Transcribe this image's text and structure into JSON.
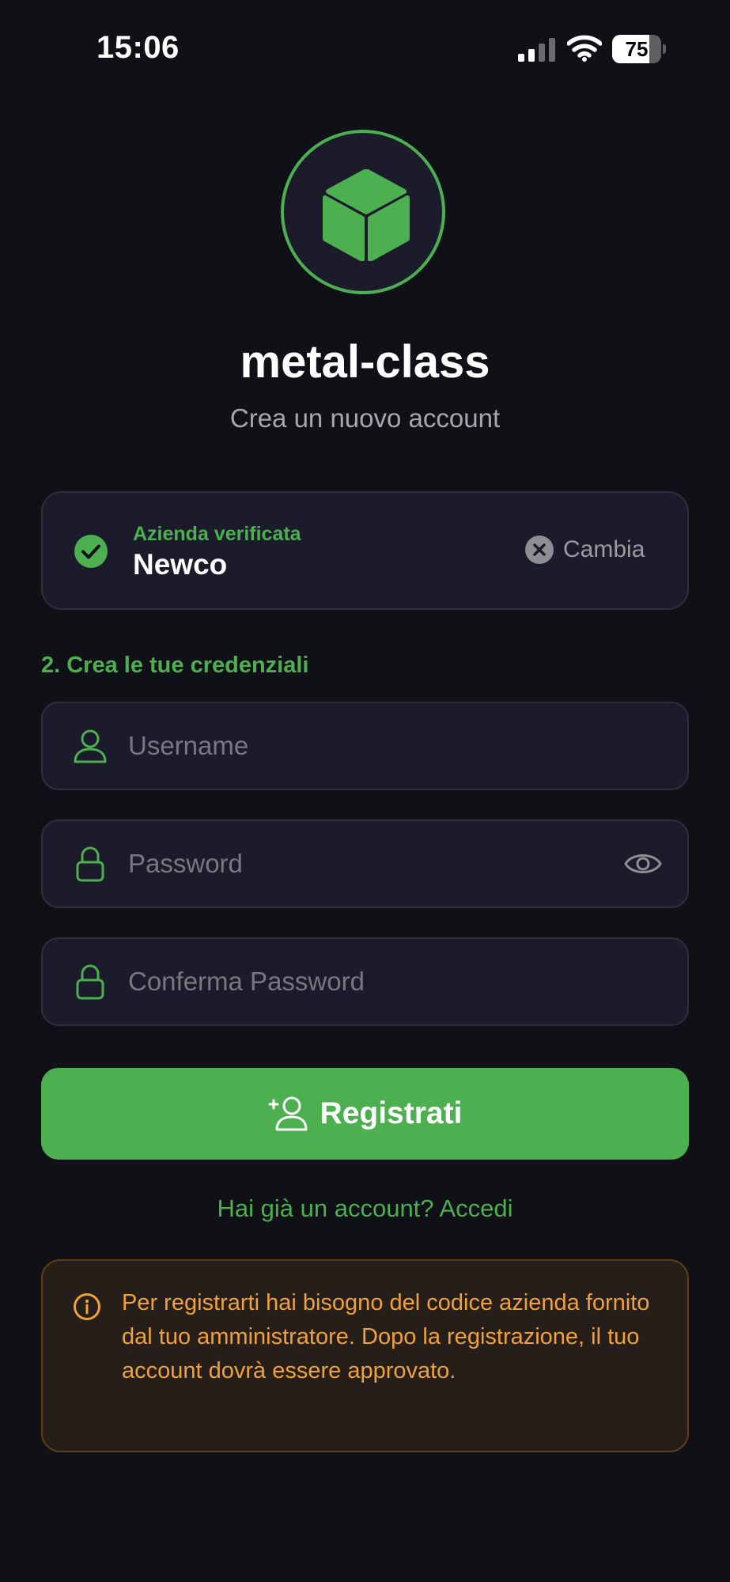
{
  "status_bar": {
    "time": "15:06",
    "battery": "75",
    "battery_level": 0.75
  },
  "app": {
    "title": "metal-class",
    "subtitle": "Crea un nuovo account",
    "logo_icon": "cube-icon",
    "accent_color": "#4caf50"
  },
  "company": {
    "verified_label": "Azienda verificata",
    "name": "Newco",
    "change_label": "Cambia"
  },
  "form": {
    "section_label": "2. Crea le tue credenziali",
    "username_placeholder": "Username",
    "password_placeholder": "Password",
    "confirm_placeholder": "Conferma Password",
    "register_label": "Registrati"
  },
  "login_link": "Hai già un account? Accedi",
  "info": {
    "text": "Per registrarti hai bisogno del codice azienda fornito dal tuo amministratore. Dopo la registrazione, il tuo account dovrà essere approvato.",
    "color": "#f0a13a"
  }
}
